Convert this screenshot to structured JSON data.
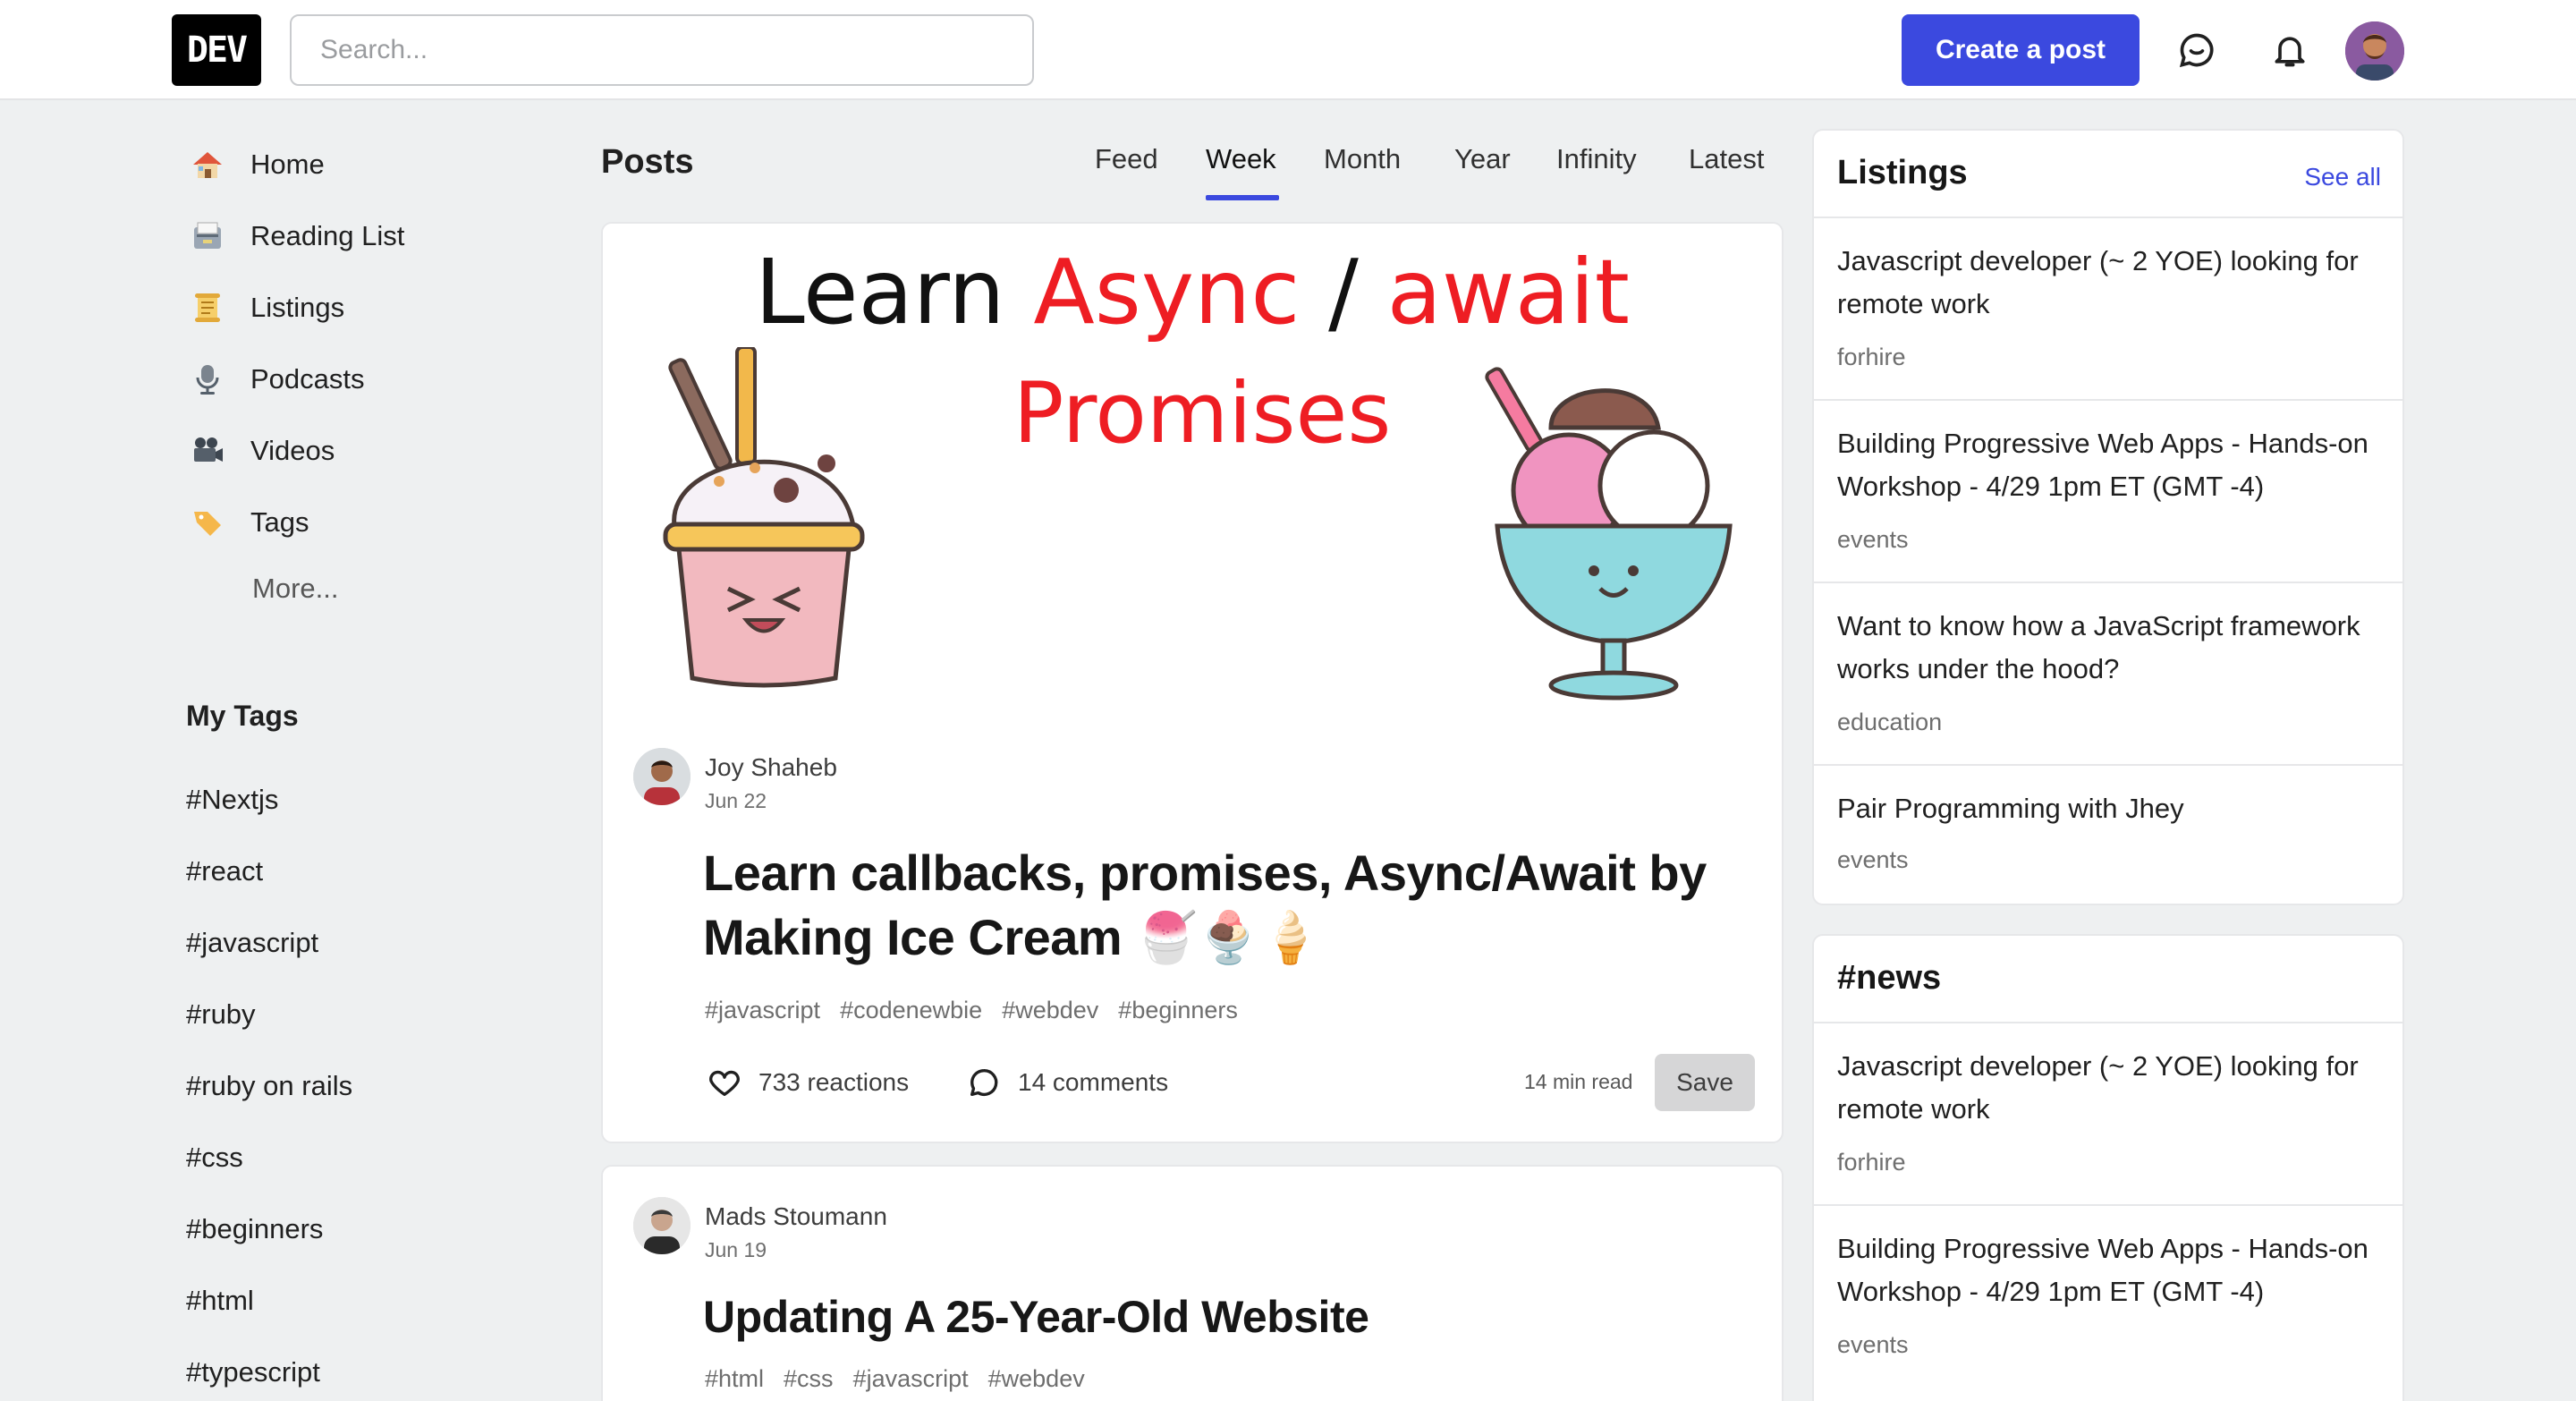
{
  "header": {
    "logo": "DEV",
    "search_placeholder": "Search...",
    "create_post": "Create a post",
    "icons": [
      "chat-icon",
      "bell-icon"
    ]
  },
  "sidebar": {
    "items": [
      {
        "label": "Home",
        "icon": "house-icon"
      },
      {
        "label": "Reading List",
        "icon": "card-box-icon"
      },
      {
        "label": "Listings",
        "icon": "scroll-icon"
      },
      {
        "label": "Podcasts",
        "icon": "microphone-icon"
      },
      {
        "label": "Videos",
        "icon": "movie-camera-icon"
      },
      {
        "label": "Tags",
        "icon": "label-icon"
      }
    ],
    "more": "More...",
    "my_tags_title": "My Tags",
    "tags": [
      "#Nextjs",
      "#react",
      "#javascript",
      "#ruby",
      "#ruby on rails",
      "#css",
      "#beginners",
      "#html",
      "#typescript"
    ]
  },
  "posts": {
    "title": "Posts",
    "tabs": [
      "Feed",
      "Week",
      "Month",
      "Year",
      "Infinity",
      "Latest"
    ],
    "active_tab": "Week",
    "items": [
      {
        "cover": {
          "line1_a": "Learn ",
          "line1_b": "Async",
          "line1_c": " / ",
          "line1_d": "await",
          "line2": "Promises"
        },
        "author": "Joy Shaheb",
        "date": "Jun 22",
        "title": "Learn callbacks, promises, Async/Await by Making Ice Cream 🍧🍨🍦",
        "tags": [
          "#javascript",
          "#codenewbie",
          "#webdev",
          "#beginners"
        ],
        "reactions": "733 reactions",
        "comments": "14 comments",
        "read_time": "14 min read",
        "save": "Save"
      },
      {
        "author": "Mads Stoumann",
        "date": "Jun 19",
        "title": "Updating A 25-Year-Old Website",
        "tags": [
          "#html",
          "#css",
          "#javascript",
          "#webdev"
        ]
      }
    ]
  },
  "listings": {
    "title": "Listings",
    "see_all": "See all",
    "items": [
      {
        "title": "Javascript developer (~ 2 YOE) looking for remote work",
        "category": "forhire"
      },
      {
        "title": "Building Progressive Web Apps - Hands-on Workshop - 4/29 1pm ET (GMT -4)",
        "category": "events"
      },
      {
        "title": "Want to know how a JavaScript framework works under the hood?",
        "category": "education"
      },
      {
        "title": "Pair Programming with Jhey",
        "category": "events"
      }
    ]
  },
  "news": {
    "title": "#news",
    "items": [
      {
        "title": "Javascript developer (~ 2 YOE) looking for remote work",
        "category": "forhire"
      },
      {
        "title": "Building Progressive Web Apps - Hands-on Workshop - 4/29 1pm ET (GMT -4)",
        "category": "events"
      }
    ]
  },
  "colors": {
    "accent": "#3b49df",
    "cover_red": "#ee1d23"
  }
}
